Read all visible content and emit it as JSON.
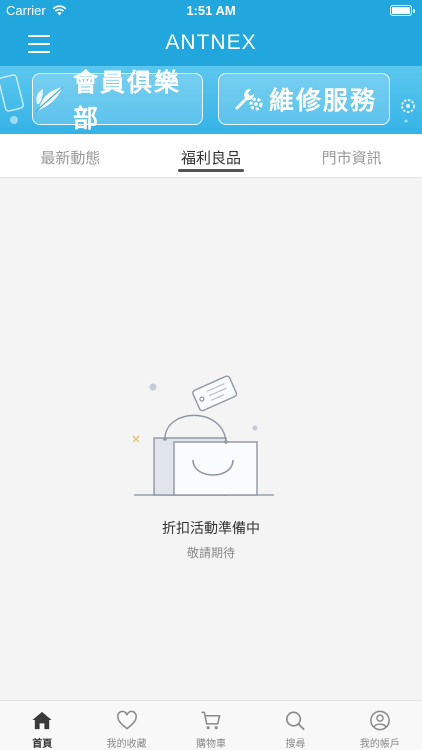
{
  "status_bar": {
    "carrier": "Carrier",
    "time": "1:51 AM"
  },
  "header": {
    "logo": "ANTNEX"
  },
  "banner": {
    "club_label": "會員俱樂部",
    "repair_label": "維修服務"
  },
  "tabs": [
    {
      "label": "最新動態",
      "active": false
    },
    {
      "label": "福利良品",
      "active": true
    },
    {
      "label": "門市資訊",
      "active": false
    }
  ],
  "empty_state": {
    "title": "折扣活動準備中",
    "subtitle": "敬請期待"
  },
  "tab_bar": [
    {
      "label": "首頁",
      "icon": "home-icon",
      "active": true
    },
    {
      "label": "我的收藏",
      "icon": "heart-icon",
      "active": false
    },
    {
      "label": "購物車",
      "icon": "cart-icon",
      "active": false
    },
    {
      "label": "搜尋",
      "icon": "search-icon",
      "active": false
    },
    {
      "label": "我的帳戶",
      "icon": "user-icon",
      "active": false
    }
  ],
  "colors": {
    "brand": "#21a7dd",
    "banner": "#4bbde9"
  }
}
